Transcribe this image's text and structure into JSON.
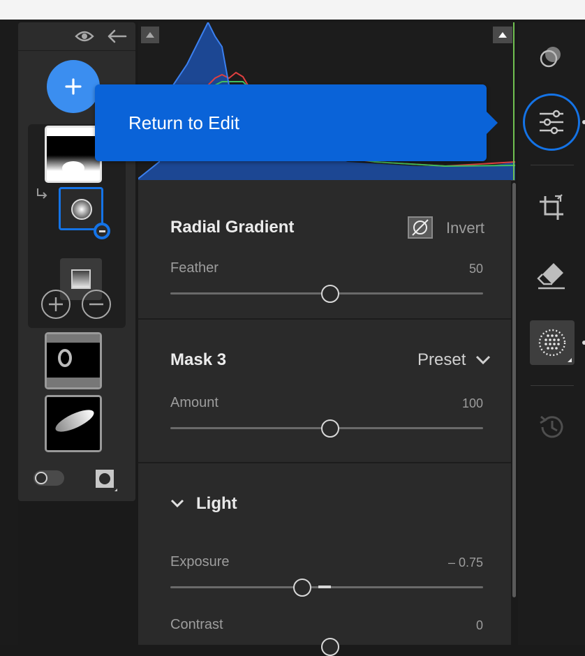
{
  "tooltip": {
    "label": "Return to Edit"
  },
  "mask_panel": {
    "header_icons": [
      "eye-icon",
      "back-arrow-icon"
    ],
    "add_icon": "plus-icon",
    "components": [
      "radial-gradient",
      "linear-gradient"
    ],
    "footer_icons": [
      "overlay-toggle",
      "mask-overlay-icon"
    ]
  },
  "radial_gradient": {
    "title": "Radial Gradient",
    "invert_label": "Invert",
    "feather_label": "Feather",
    "feather_value": "50",
    "feather_level": 0.5
  },
  "mask": {
    "title": "Mask 3",
    "preset_label": "Preset",
    "amount_label": "Amount",
    "amount_value": "100",
    "amount_level": 0.5
  },
  "light": {
    "title": "Light",
    "exposure_label": "Exposure",
    "exposure_value": "– 0.75",
    "exposure_level": 0.4125,
    "contrast_label": "Contrast",
    "contrast_value": "0",
    "contrast_level": 0.5
  },
  "right_rail": {
    "icons": [
      "presets-icon",
      "edit-icon",
      "crop-icon",
      "heal-icon",
      "masking-icon",
      "history-icon"
    ]
  },
  "colors": {
    "accent": "#0a63d8",
    "add_button": "#3b8ef0",
    "selected_outline": "#1473e6"
  }
}
